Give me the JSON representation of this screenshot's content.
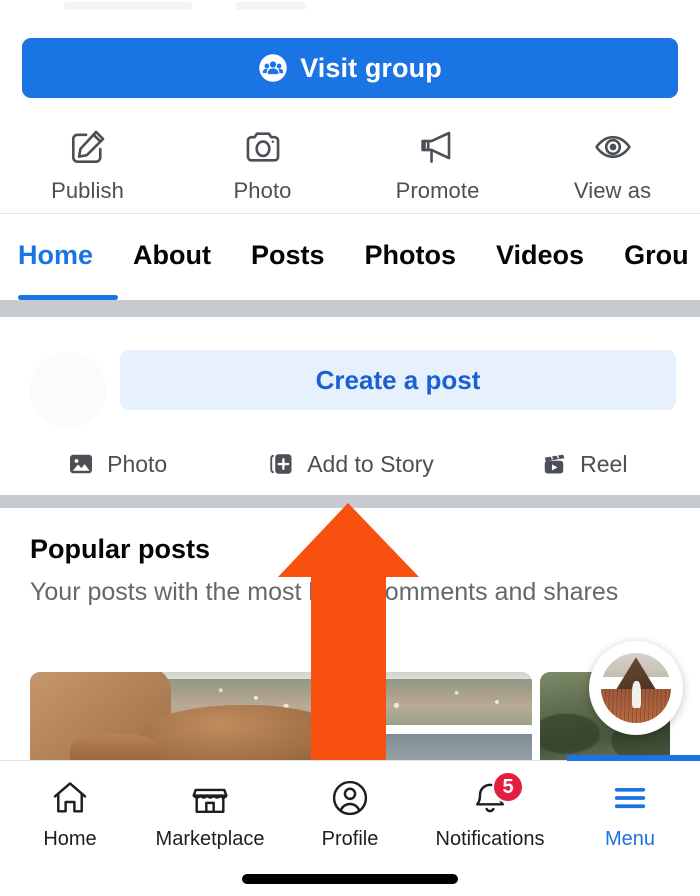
{
  "header": {
    "visit_group_button": "Visit group",
    "visit_group_icon": "group-people-icon",
    "accent_color": "#1b74e4"
  },
  "action_row": {
    "items": [
      {
        "label": "Publish",
        "icon": "compose-pencil-icon"
      },
      {
        "label": "Photo",
        "icon": "camera-icon"
      },
      {
        "label": "Promote",
        "icon": "megaphone-icon"
      },
      {
        "label": "View as",
        "icon": "eye-icon"
      }
    ]
  },
  "tabs": {
    "items": [
      {
        "label": "Home",
        "active": true
      },
      {
        "label": "About",
        "active": false
      },
      {
        "label": "Posts",
        "active": false
      },
      {
        "label": "Photos",
        "active": false
      },
      {
        "label": "Videos",
        "active": false
      },
      {
        "label": "Grou",
        "active": false
      }
    ],
    "active_color": "#1b74e4"
  },
  "composer": {
    "create_post_label": "Create a post",
    "create_post_text_color": "#1b61d1",
    "create_post_bg_color": "#e7f0fd",
    "avatar": "profile-avatar-placeholder",
    "quick_actions": [
      {
        "label": "Photo",
        "icon": "photo-image-icon"
      },
      {
        "label": "Add to Story",
        "icon": "add-to-story-icon"
      },
      {
        "label": "Reel",
        "icon": "reel-clapper-icon"
      }
    ]
  },
  "popular_posts": {
    "title": "Popular posts",
    "subtitle": "Your posts with the most likes, comments and shares"
  },
  "photos": {
    "items": [
      {
        "name": "coastal-boulders-photo"
      },
      {
        "name": "forest-photo"
      }
    ],
    "story_bubble": "story-thumbnail-person-in-field"
  },
  "annotation": {
    "arrow_color": "#f8500f",
    "arrow_points_to": "Add to Story"
  },
  "bottom_nav": {
    "items": [
      {
        "label": "Home",
        "icon": "home-icon",
        "active": false,
        "badge": ""
      },
      {
        "label": "Marketplace",
        "icon": "marketplace-storefront-icon",
        "active": false,
        "badge": ""
      },
      {
        "label": "Profile",
        "icon": "profile-person-icon",
        "active": false,
        "badge": ""
      },
      {
        "label": "Notifications",
        "icon": "bell-icon",
        "active": false,
        "badge": "5"
      },
      {
        "label": "Menu",
        "icon": "hamburger-menu-icon",
        "active": true,
        "badge": ""
      }
    ],
    "badge_color": "#e41e3f",
    "active_color": "#1b74e4"
  }
}
